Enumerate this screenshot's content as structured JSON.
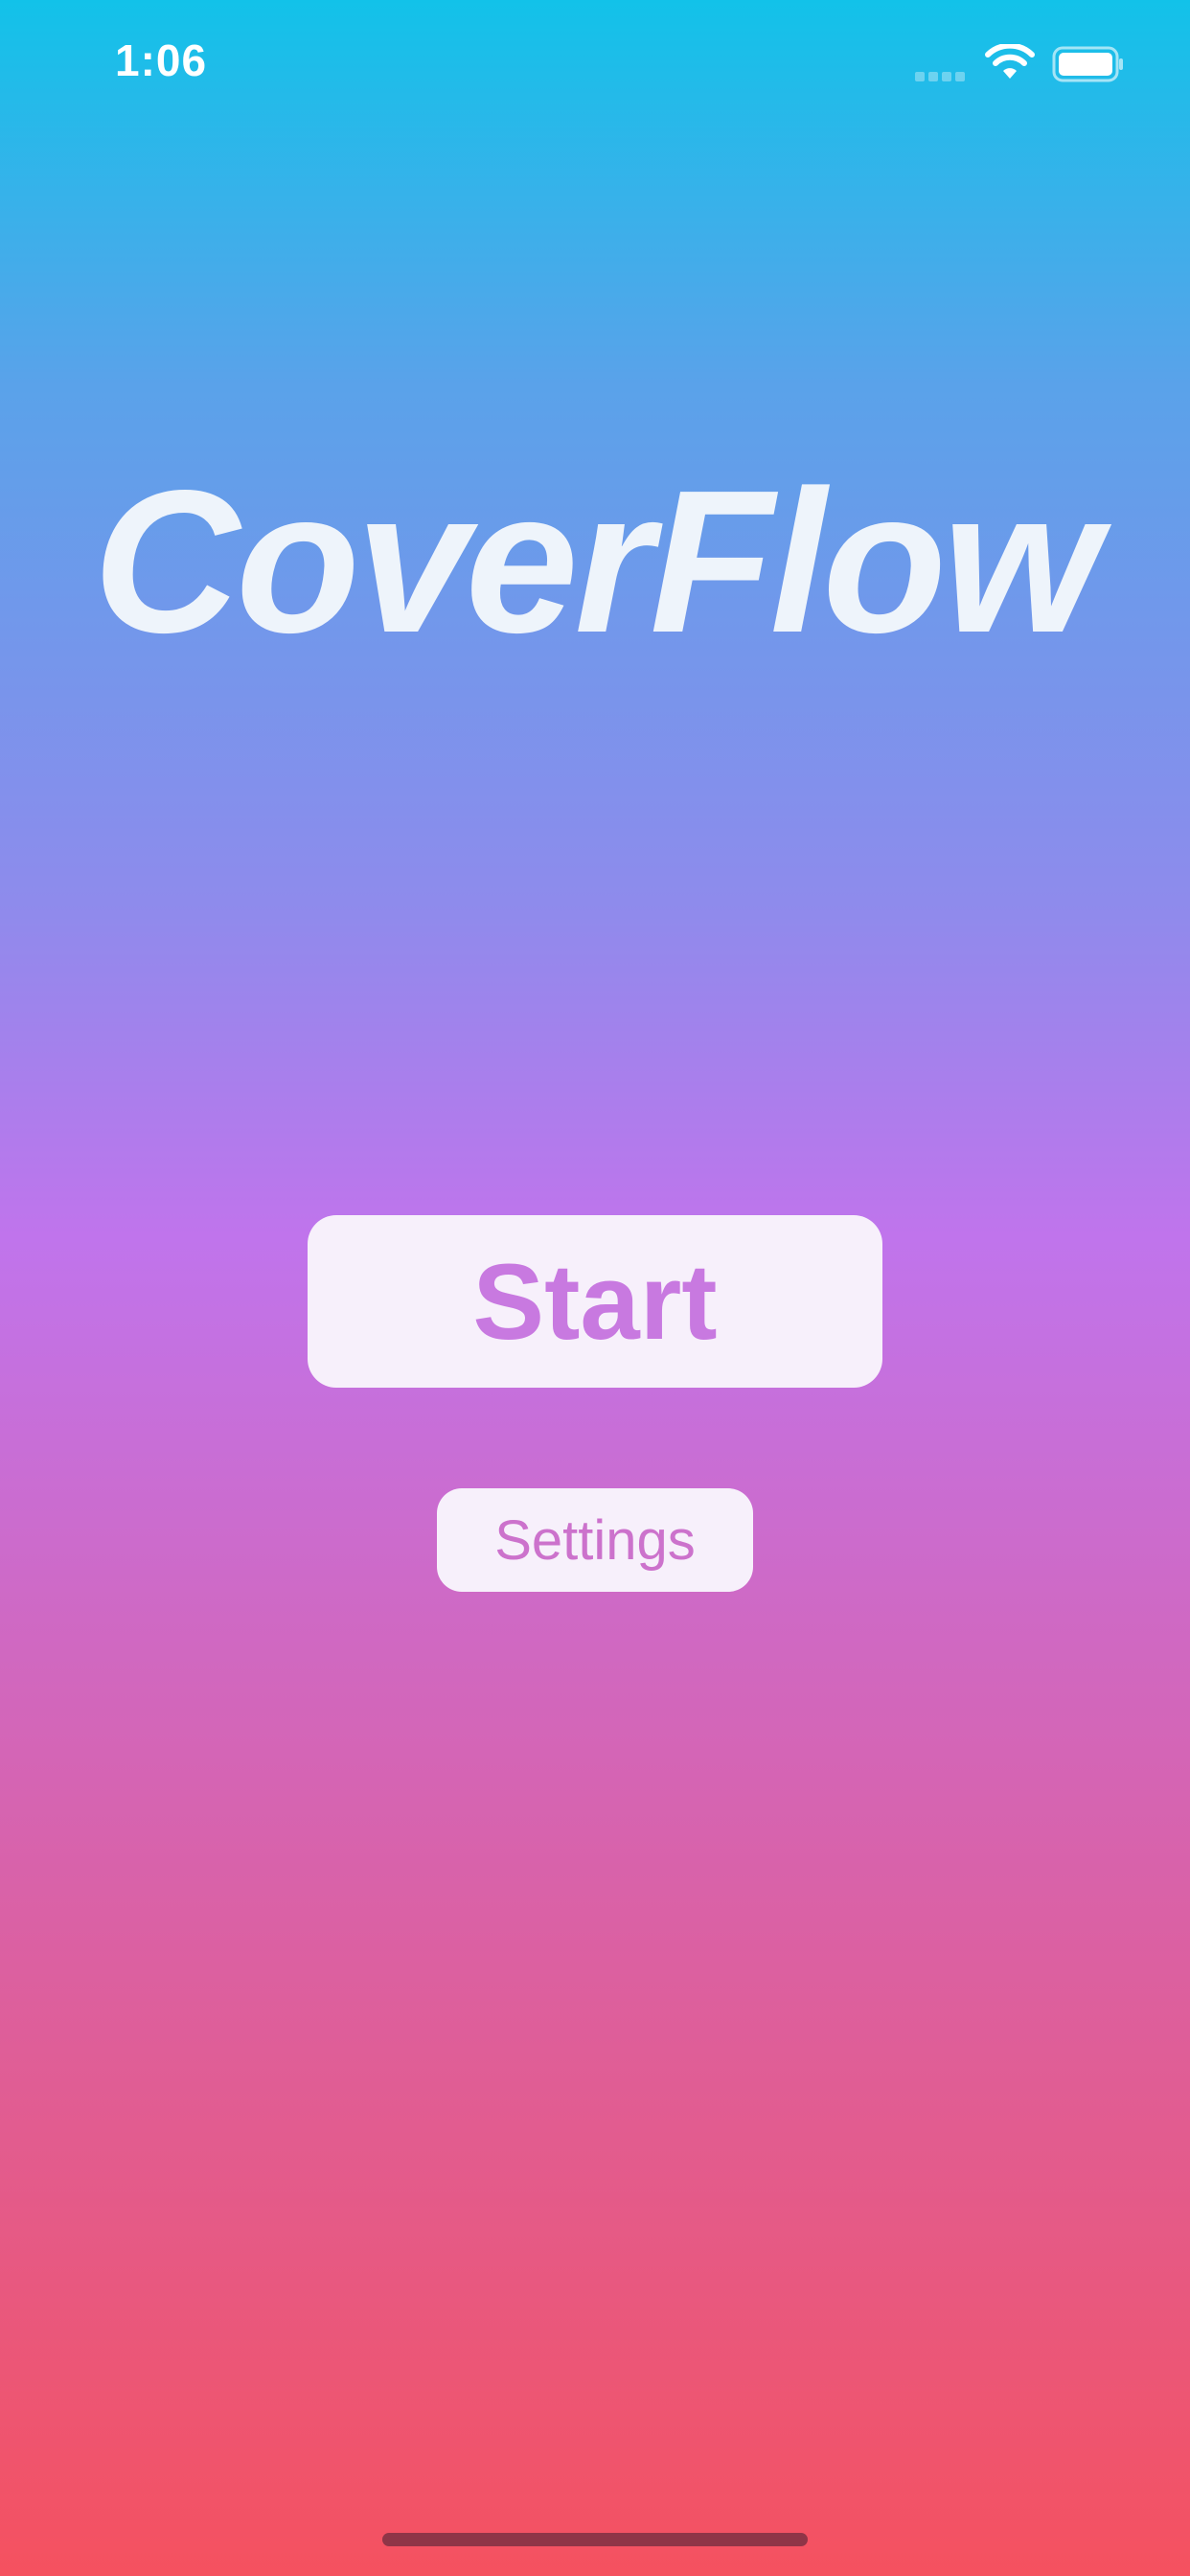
{
  "status_bar": {
    "time": "1:06",
    "icons": [
      "cellular-signal-icon",
      "wifi-icon",
      "battery-icon"
    ]
  },
  "app": {
    "title": "CoverFlow"
  },
  "buttons": {
    "start_label": "Start",
    "settings_label": "Settings"
  },
  "colors": {
    "gradient_top": "#12c2e9",
    "gradient_middle": "#c074ec",
    "gradient_bottom": "#f5515f",
    "button_background": "#f7f0fb",
    "start_text": "#c879e0",
    "settings_text": "#cc72cc",
    "title_text": "#eef4fb"
  }
}
